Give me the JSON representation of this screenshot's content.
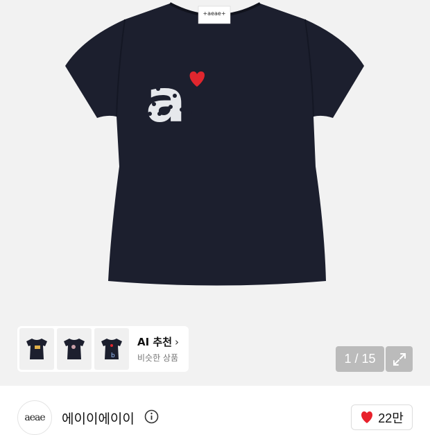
{
  "product_image": {
    "label_text": "+aeae+",
    "thumbnails": [
      "thumb-shirt-1",
      "thumb-shirt-2",
      "thumb-shirt-3"
    ]
  },
  "ai_recommend": {
    "title": "AI 추천",
    "subtitle": "비슷한 상품"
  },
  "gallery": {
    "counter": "1 / 15"
  },
  "brand": {
    "logo_text": "aeae",
    "name": "에이이에이이"
  },
  "like": {
    "count": "22만",
    "color": "#e8212b"
  },
  "colors": {
    "shirt": "#1c1f2e",
    "heart": "#e0262e",
    "background": "#f2f2f2"
  }
}
